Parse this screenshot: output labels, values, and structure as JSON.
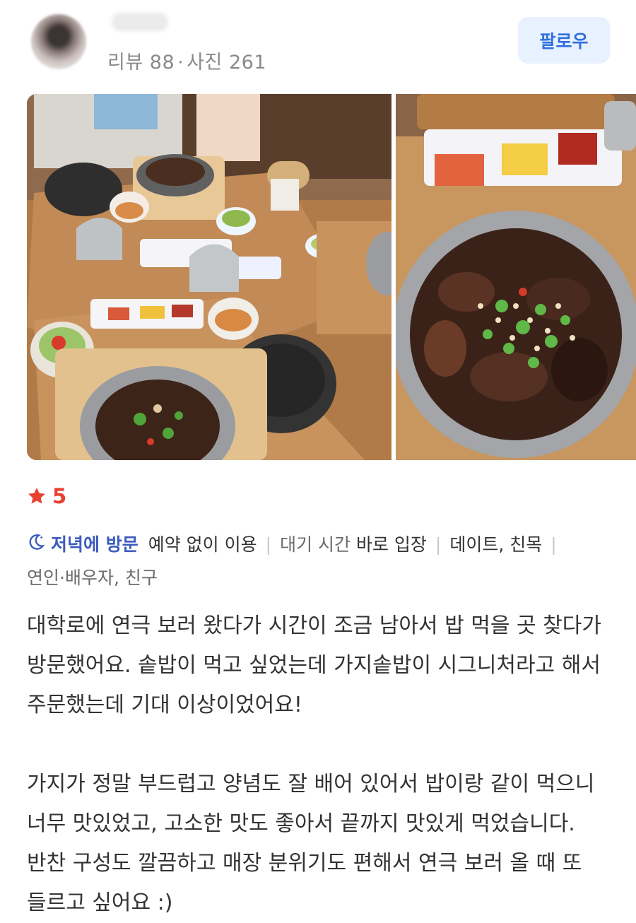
{
  "reviewer": {
    "stats_reviews": "리뷰 88",
    "stats_separator": "·",
    "stats_photos": "사진 261",
    "follow_label": "팔로우"
  },
  "rating": {
    "value": "5"
  },
  "visit_info": {
    "time_label": "저녁에 방문",
    "reservation": "예약 없이 이용",
    "wait_label": "대기 시간",
    "wait_value": "바로 입장",
    "purpose": "데이트, 친목",
    "companions": "연인·배우자, 친구"
  },
  "review": {
    "text": "대학로에 연극 보러 왔다가 시간이 조금 남아서 밥 먹을 곳 찾다가 방문했어요. 솥밥이 먹고 싶었는데 가지솥밥이 시그니처라고 해서 주문했는데 기대 이상이었어요!\n\n가지가 정말 부드럽고 양념도 잘 배어 있어서 밥이랑 같이 먹으니 너무 맛있었고, 고소한 맛도 좋아서 끝까지 맛있게 먹었습니다. 반찬 구성도 깔끔하고 매장 분위기도 편해서 연극 보러 올 때 또 들르고 싶어요 :)"
  },
  "colors": {
    "follow_bg": "#e8f1ff",
    "follow_text": "#2f6fe0",
    "star": "#e8412f",
    "visit_time": "#3b5bbd"
  }
}
